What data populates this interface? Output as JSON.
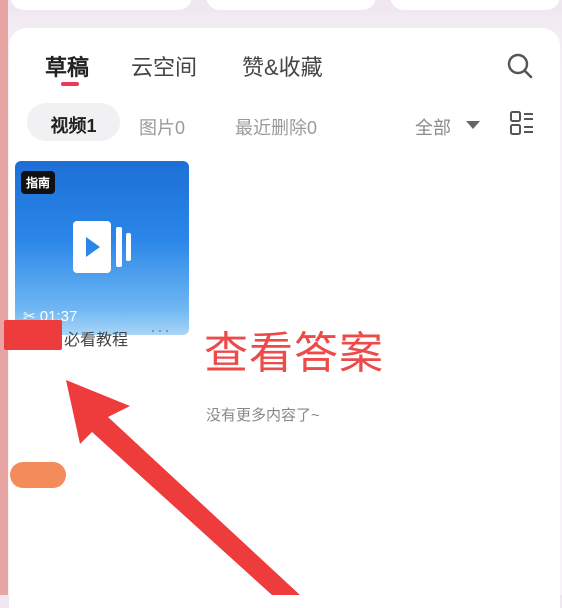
{
  "tabs": [
    {
      "label": "草稿",
      "active": true
    },
    {
      "label": "云空间",
      "active": false
    },
    {
      "label": "赞&收藏",
      "active": false
    }
  ],
  "subtabs": {
    "video": "视频1",
    "images": "图片0",
    "recent_deleted": "最近删除0",
    "filter": "全部"
  },
  "draft": {
    "badge": "指南",
    "duration": "01:37",
    "title": "必看教程",
    "more": "···"
  },
  "overlay": {
    "text": "查看答案"
  },
  "end_message": "没有更多内容了~",
  "colors": {
    "accent_pink": "#f0355f",
    "annotation_red": "#ee3b3b",
    "thumbnail_blue": "#2b86e8"
  },
  "icons": {
    "search": "search-icon",
    "layout": "layout-icon",
    "video": "video-icon",
    "scissors": "scissors-icon"
  }
}
